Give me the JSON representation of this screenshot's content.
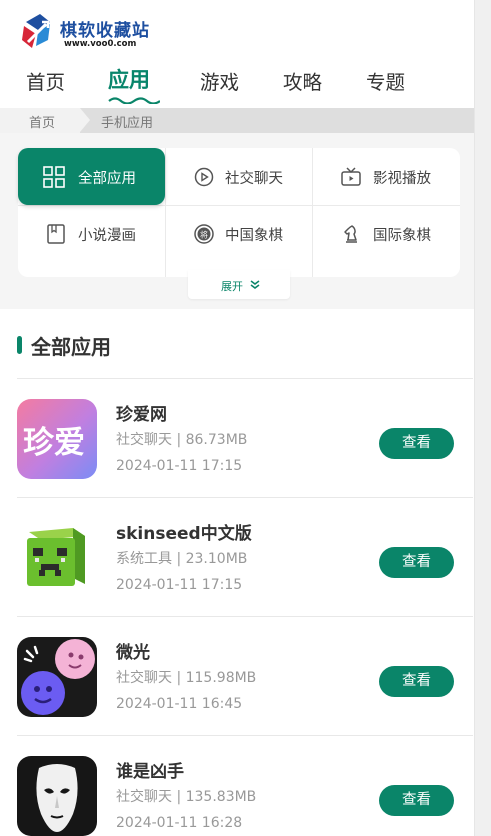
{
  "logo": {
    "name": "棋软收藏站",
    "url": "www.voo0.com"
  },
  "nav": [
    "首页",
    "应用",
    "游戏",
    "攻略",
    "专题"
  ],
  "breadcrumb": {
    "home": "首页",
    "current": "手机应用"
  },
  "categories": [
    "全部应用",
    "社交聊天",
    "影视播放",
    "小说漫画",
    "中国象棋",
    "国际象棋"
  ],
  "expand_label": "展开",
  "section_title": "全部应用",
  "apps": [
    {
      "title": "珍爱网",
      "meta": "社交聊天 | 86.73MB",
      "date": "2024-01-11 17:15",
      "button": "查看",
      "icon_text": "珍爱"
    },
    {
      "title": "skinseed中文版",
      "meta": "系统工具 | 23.10MB",
      "date": "2024-01-11 17:15",
      "button": "查看"
    },
    {
      "title": "微光",
      "meta": "社交聊天 | 115.98MB",
      "date": "2024-01-11 16:45",
      "button": "查看"
    },
    {
      "title": "谁是凶手",
      "meta": "社交聊天 | 135.83MB",
      "date": "2024-01-11 16:28",
      "button": "查看"
    }
  ],
  "colors": {
    "accent": "#0a8569",
    "logo_blue": "#1e4fa0"
  }
}
